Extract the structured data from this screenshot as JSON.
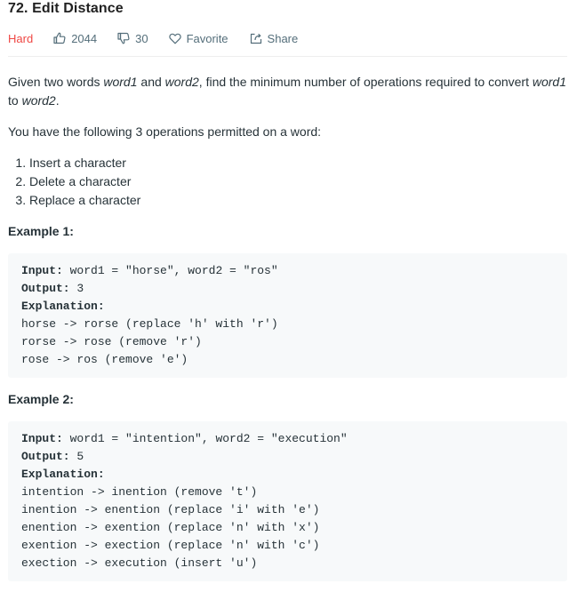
{
  "problem": {
    "title": "72. Edit Distance",
    "difficulty": "Hard",
    "likes": "2044",
    "dislikes": "30",
    "favorite_label": "Favorite",
    "share_label": "Share",
    "difficulty_color": "#ef4743"
  },
  "description": {
    "p1_a": "Given two words ",
    "p1_word1": "word1",
    "p1_b": " and ",
    "p1_word2": "word2",
    "p1_c": ", find the minimum number of operations required to convert ",
    "p1_word1b": "word1",
    "p1_d": " to ",
    "p1_word2b": "word2",
    "p1_e": ".",
    "p2": "You have the following 3 operations permitted on a word:",
    "operations": [
      "Insert a character",
      "Delete a character",
      "Replace a character"
    ]
  },
  "examples": [
    {
      "heading": "Example 1:",
      "input_label": "Input:",
      "input": " word1 = \"horse\", word2 = \"ros\"",
      "output_label": "Output:",
      "output": " 3",
      "explanation_label": "Explanation:",
      "steps": [
        "horse -> rorse (replace 'h' with 'r')",
        "rorse -> rose (remove 'r')",
        "rose -> ros (remove 'e')"
      ]
    },
    {
      "heading": "Example 2:",
      "input_label": "Input:",
      "input": " word1 = \"intention\", word2 = \"execution\"",
      "output_label": "Output:",
      "output": " 5",
      "explanation_label": "Explanation:",
      "steps": [
        "intention -> inention (remove 't')",
        "inention -> enention (replace 'i' with 'e')",
        "enention -> exention (replace 'n' with 'x')",
        "exention -> exection (replace 'n' with 'c')",
        "exection -> execution (insert 'u')"
      ]
    }
  ]
}
